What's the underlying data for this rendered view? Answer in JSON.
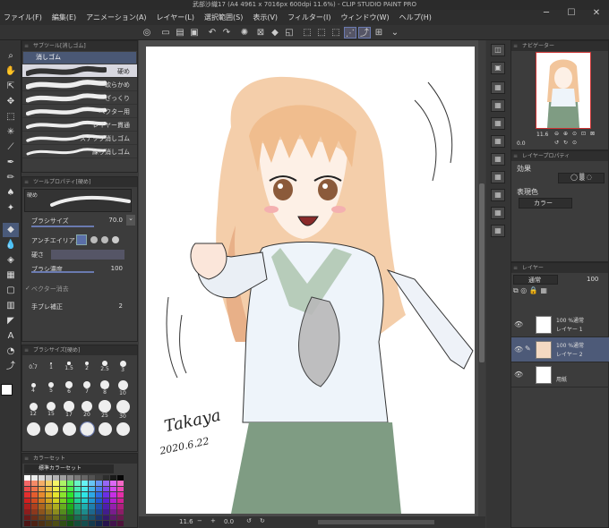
{
  "window": {
    "title": "武部沙織17 (A4 4961 x 7016px 600dpi 11.6%) - CLIP STUDIO PAINT PRO"
  },
  "menu": [
    "ファイル(F)",
    "編集(E)",
    "アニメーション(A)",
    "レイヤー(L)",
    "選択範囲(S)",
    "表示(V)",
    "フィルター(I)",
    "ウィンドウ(W)",
    "ヘルプ(H)"
  ],
  "subtool": {
    "header": "サブツール[消しゴム]",
    "group_tab": "消しゴム",
    "items": [
      "硬め",
      "軟らかめ",
      "ざっくり",
      "ベクター用",
      "レイヤー貫通",
      "スナップ消しゴム",
      "練り消しゴム"
    ]
  },
  "toolprop": {
    "header": "ツールプロパティ[硬め]",
    "preset_name": "硬め",
    "brush_size_label": "ブラシサイズ",
    "brush_size_value": "70.0",
    "antialias_label": "アンチエイリアス",
    "hardness_label": "硬さ",
    "density_label": "ブラシ濃度",
    "density_value": "100",
    "vector_erase_label": "ベクター消去",
    "stabilize_label": "手ブレ補正",
    "stabilize_value": "2"
  },
  "brushsize": {
    "header": "ブラシサイズ[硬め]",
    "row1": [
      "0.7",
      "1",
      "1.5",
      "2",
      "2.5",
      "3"
    ],
    "row2": [
      "4",
      "5",
      "6",
      "7",
      "8",
      "10"
    ],
    "row3": [
      "12",
      "15",
      "17",
      "20",
      "25",
      "30"
    ]
  },
  "colorset": {
    "header": "カラーセット",
    "set_name": "標準カラーセット"
  },
  "canvas": {
    "signature": "Takaya",
    "date": "2020.6.22"
  },
  "status": {
    "zoom": "11.6",
    "rotation": "0.0"
  },
  "navigator": {
    "header": "ナビゲーター",
    "zoom": "11.6",
    "rotation": "0.0"
  },
  "layerprop": {
    "header": "レイヤープロパティ",
    "effect_label": "効果",
    "express_label": "表現色",
    "express_value": "カラー"
  },
  "layers": {
    "header": "レイヤー",
    "blend_mode": "通常",
    "opacity": "100",
    "items": [
      {
        "line1": "100 %通常",
        "line2": "レイヤー 1"
      },
      {
        "line1": "100 %通常",
        "line2": "レイヤー 2"
      },
      {
        "line1": "",
        "line2": "用紙"
      }
    ]
  },
  "colors": {
    "accent": "#4d5a78",
    "main_color": "#ffffff",
    "sub_color": "#e8a090"
  }
}
